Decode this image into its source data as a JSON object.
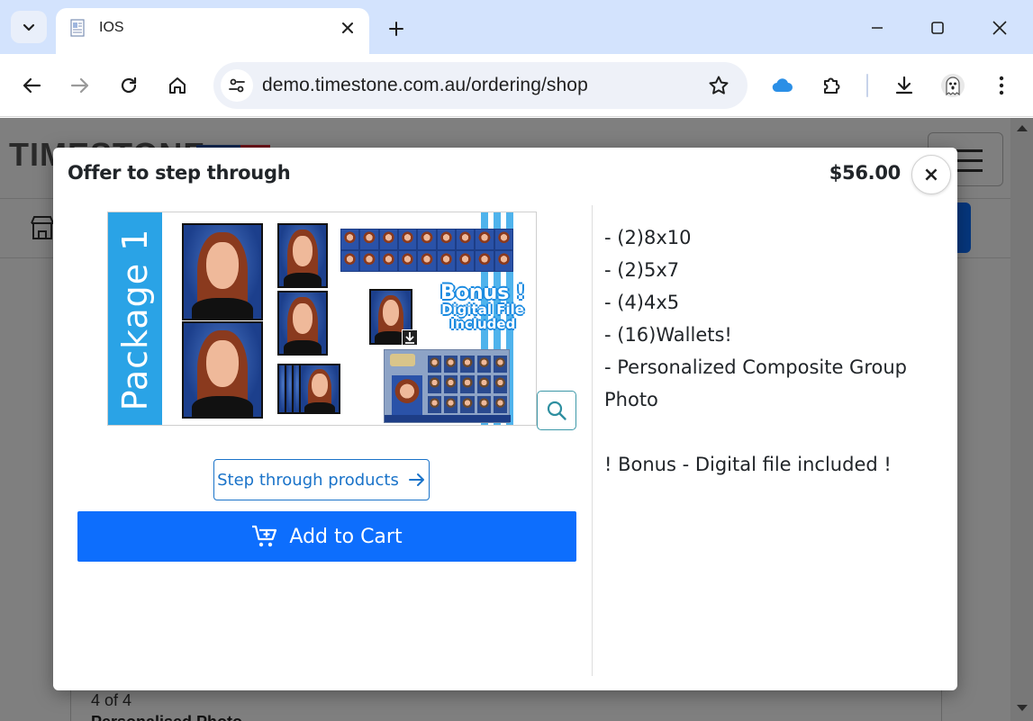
{
  "browser": {
    "tab_title": "IOS",
    "url": "demo.timestone.com.au/ordering/shop"
  },
  "page": {
    "logo_text": "TIMESTONE",
    "card_count": "4 of 4",
    "card_title": "Personalised Photo"
  },
  "modal": {
    "title": "Offer to step through",
    "price": "$56.00",
    "close_label": "×",
    "image": {
      "package_label": "Package 1",
      "bonus_line1": "Bonus !",
      "bonus_line2": "Digital File",
      "bonus_line3": "Included"
    },
    "step_button_label": "Step through products",
    "add_to_cart_label": "Add to Cart",
    "description": [
      "- (2)8x10",
      "- (2)5x7",
      "- (4)4x5",
      "- (16)Wallets!",
      "- Personalized Composite Group Photo",
      "",
      "! Bonus - Digital file included !"
    ]
  },
  "colors": {
    "primary": "#0d6efd",
    "outline": "#1a73c9",
    "package_band": "#2aa3e6",
    "tabbar": "#d3e3fd"
  },
  "icons": [
    "tab-list-icon",
    "document-favicon-icon",
    "close-icon",
    "plus-icon",
    "minimize-icon",
    "maximize-icon",
    "back-icon",
    "forward-icon",
    "reload-icon",
    "home-icon",
    "site-settings-icon",
    "star-icon",
    "cloud-icon",
    "puzzle-icon",
    "download-icon",
    "ghost-icon",
    "more-vert-icon",
    "search-icon",
    "arrow-right-icon",
    "cart-plus-icon"
  ]
}
